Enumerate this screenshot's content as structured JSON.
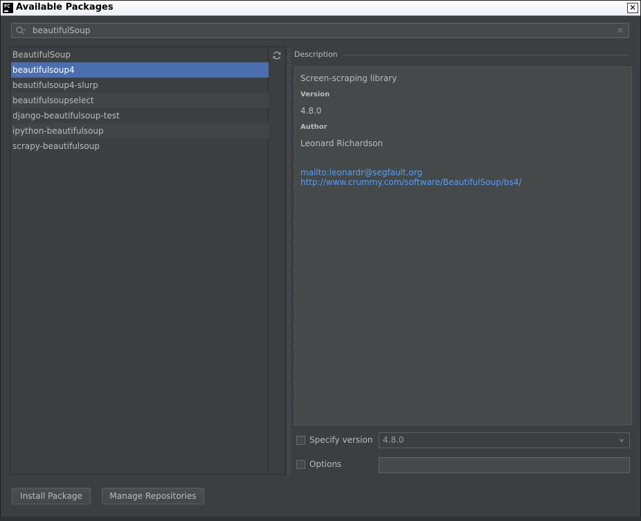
{
  "window": {
    "title": "Available Packages",
    "app_icon_text": "PC"
  },
  "search": {
    "value": "beautifulSoup"
  },
  "packages": [
    "BeautifulSoup",
    "beautifulsoup4",
    "beautifulsoup4-slurp",
    "beautifulsoupselect",
    "django-beautifulsoup-test",
    "ipython-beautifulsoup",
    "scrapy-beautifulsoup"
  ],
  "selected_package": "beautifulsoup4",
  "description": {
    "header": "Description",
    "summary": "Screen-scraping library",
    "version_label": "Version",
    "version_value": "4.8.0",
    "author_label": "Author",
    "author_value": "Leonard Richardson",
    "mail_link": "mailto:leonardr@segfault.org",
    "home_link": "http://www.crummy.com/software/BeautifulSoup/bs4/"
  },
  "options": {
    "specify_version_label": "Specify version",
    "specify_version_checked": false,
    "version_select_value": "4.8.0",
    "options_label": "Options",
    "options_checked": false,
    "options_value": ""
  },
  "buttons": {
    "install": "Install Package",
    "manage": "Manage Repositories"
  },
  "colors": {
    "selection": "#4b6eaf",
    "link": "#589df6",
    "background": "#3c3f41"
  }
}
